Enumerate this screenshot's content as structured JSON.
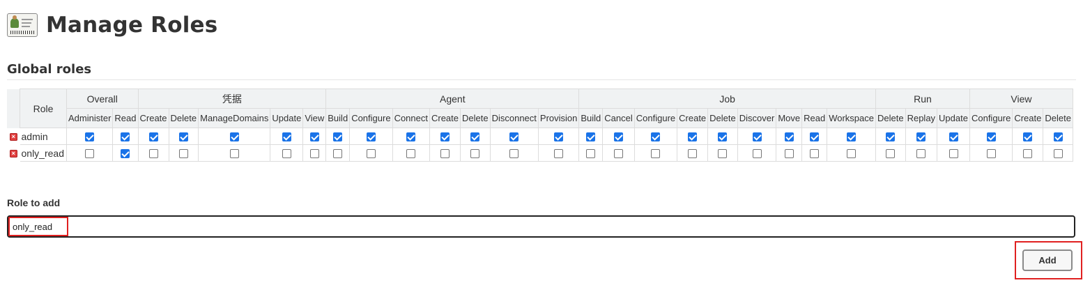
{
  "page": {
    "title": "Manage Roles",
    "section_title": "Global roles",
    "role_header": "Role"
  },
  "groups": [
    {
      "name": "Overall",
      "perms": [
        "Administer",
        "Read"
      ]
    },
    {
      "name": "凭据",
      "perms": [
        "Create",
        "Delete",
        "ManageDomains",
        "Update",
        "View"
      ]
    },
    {
      "name": "Agent",
      "perms": [
        "Build",
        "Configure",
        "Connect",
        "Create",
        "Delete",
        "Disconnect",
        "Provision"
      ]
    },
    {
      "name": "Job",
      "perms": [
        "Build",
        "Cancel",
        "Configure",
        "Create",
        "Delete",
        "Discover",
        "Move",
        "Read",
        "Workspace"
      ]
    },
    {
      "name": "Run",
      "perms": [
        "Delete",
        "Replay",
        "Update"
      ]
    },
    {
      "name": "View",
      "perms": [
        "Configure",
        "Create",
        "Delete"
      ]
    }
  ],
  "roles": [
    {
      "name": "admin",
      "checks": [
        1,
        1,
        1,
        1,
        1,
        1,
        1,
        1,
        1,
        1,
        1,
        1,
        1,
        1,
        1,
        1,
        1,
        1,
        1,
        1,
        1,
        1,
        1,
        1,
        1,
        1,
        1,
        1,
        1
      ]
    },
    {
      "name": "only_read",
      "checks": [
        0,
        1,
        0,
        0,
        0,
        0,
        0,
        0,
        0,
        0,
        0,
        0,
        0,
        0,
        0,
        0,
        0,
        0,
        0,
        0,
        0,
        0,
        0,
        0,
        0,
        0,
        0,
        0,
        0
      ]
    }
  ],
  "add_role": {
    "label": "Role to add",
    "value": "only_read",
    "button_label": "Add"
  },
  "icons": {
    "header": "user-id-card-icon",
    "remove": "delete-role-icon"
  },
  "colors": {
    "checkbox_checked": "#1a73e8",
    "highlight": "#e02020"
  }
}
